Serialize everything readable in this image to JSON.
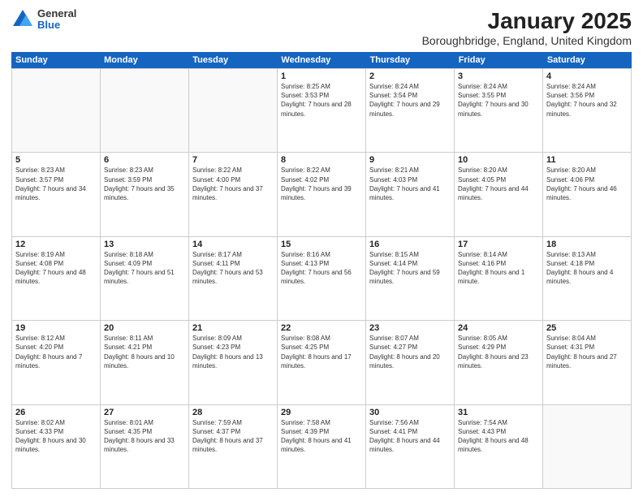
{
  "logo": {
    "general": "General",
    "blue": "Blue"
  },
  "title": "January 2025",
  "subtitle": "Boroughbridge, England, United Kingdom",
  "header_days": [
    "Sunday",
    "Monday",
    "Tuesday",
    "Wednesday",
    "Thursday",
    "Friday",
    "Saturday"
  ],
  "weeks": [
    [
      {
        "day": "",
        "empty": true
      },
      {
        "day": "",
        "empty": true
      },
      {
        "day": "",
        "empty": true
      },
      {
        "day": "1",
        "sunrise": "8:25 AM",
        "sunset": "3:53 PM",
        "daylight": "7 hours and 28 minutes."
      },
      {
        "day": "2",
        "sunrise": "8:24 AM",
        "sunset": "3:54 PM",
        "daylight": "7 hours and 29 minutes."
      },
      {
        "day": "3",
        "sunrise": "8:24 AM",
        "sunset": "3:55 PM",
        "daylight": "7 hours and 30 minutes."
      },
      {
        "day": "4",
        "sunrise": "8:24 AM",
        "sunset": "3:56 PM",
        "daylight": "7 hours and 32 minutes."
      }
    ],
    [
      {
        "day": "5",
        "sunrise": "8:23 AM",
        "sunset": "3:57 PM",
        "daylight": "7 hours and 34 minutes."
      },
      {
        "day": "6",
        "sunrise": "8:23 AM",
        "sunset": "3:59 PM",
        "daylight": "7 hours and 35 minutes."
      },
      {
        "day": "7",
        "sunrise": "8:22 AM",
        "sunset": "4:00 PM",
        "daylight": "7 hours and 37 minutes."
      },
      {
        "day": "8",
        "sunrise": "8:22 AM",
        "sunset": "4:02 PM",
        "daylight": "7 hours and 39 minutes."
      },
      {
        "day": "9",
        "sunrise": "8:21 AM",
        "sunset": "4:03 PM",
        "daylight": "7 hours and 41 minutes."
      },
      {
        "day": "10",
        "sunrise": "8:20 AM",
        "sunset": "4:05 PM",
        "daylight": "7 hours and 44 minutes."
      },
      {
        "day": "11",
        "sunrise": "8:20 AM",
        "sunset": "4:06 PM",
        "daylight": "7 hours and 46 minutes."
      }
    ],
    [
      {
        "day": "12",
        "sunrise": "8:19 AM",
        "sunset": "4:08 PM",
        "daylight": "7 hours and 48 minutes."
      },
      {
        "day": "13",
        "sunrise": "8:18 AM",
        "sunset": "4:09 PM",
        "daylight": "7 hours and 51 minutes."
      },
      {
        "day": "14",
        "sunrise": "8:17 AM",
        "sunset": "4:11 PM",
        "daylight": "7 hours and 53 minutes."
      },
      {
        "day": "15",
        "sunrise": "8:16 AM",
        "sunset": "4:13 PM",
        "daylight": "7 hours and 56 minutes."
      },
      {
        "day": "16",
        "sunrise": "8:15 AM",
        "sunset": "4:14 PM",
        "daylight": "7 hours and 59 minutes."
      },
      {
        "day": "17",
        "sunrise": "8:14 AM",
        "sunset": "4:16 PM",
        "daylight": "8 hours and 1 minute."
      },
      {
        "day": "18",
        "sunrise": "8:13 AM",
        "sunset": "4:18 PM",
        "daylight": "8 hours and 4 minutes."
      }
    ],
    [
      {
        "day": "19",
        "sunrise": "8:12 AM",
        "sunset": "4:20 PM",
        "daylight": "8 hours and 7 minutes."
      },
      {
        "day": "20",
        "sunrise": "8:11 AM",
        "sunset": "4:21 PM",
        "daylight": "8 hours and 10 minutes."
      },
      {
        "day": "21",
        "sunrise": "8:09 AM",
        "sunset": "4:23 PM",
        "daylight": "8 hours and 13 minutes."
      },
      {
        "day": "22",
        "sunrise": "8:08 AM",
        "sunset": "4:25 PM",
        "daylight": "8 hours and 17 minutes."
      },
      {
        "day": "23",
        "sunrise": "8:07 AM",
        "sunset": "4:27 PM",
        "daylight": "8 hours and 20 minutes."
      },
      {
        "day": "24",
        "sunrise": "8:05 AM",
        "sunset": "4:29 PM",
        "daylight": "8 hours and 23 minutes."
      },
      {
        "day": "25",
        "sunrise": "8:04 AM",
        "sunset": "4:31 PM",
        "daylight": "8 hours and 27 minutes."
      }
    ],
    [
      {
        "day": "26",
        "sunrise": "8:02 AM",
        "sunset": "4:33 PM",
        "daylight": "8 hours and 30 minutes."
      },
      {
        "day": "27",
        "sunrise": "8:01 AM",
        "sunset": "4:35 PM",
        "daylight": "8 hours and 33 minutes."
      },
      {
        "day": "28",
        "sunrise": "7:59 AM",
        "sunset": "4:37 PM",
        "daylight": "8 hours and 37 minutes."
      },
      {
        "day": "29",
        "sunrise": "7:58 AM",
        "sunset": "4:39 PM",
        "daylight": "8 hours and 41 minutes."
      },
      {
        "day": "30",
        "sunrise": "7:56 AM",
        "sunset": "4:41 PM",
        "daylight": "8 hours and 44 minutes."
      },
      {
        "day": "31",
        "sunrise": "7:54 AM",
        "sunset": "4:43 PM",
        "daylight": "8 hours and 48 minutes."
      },
      {
        "day": "",
        "empty": true
      }
    ]
  ]
}
